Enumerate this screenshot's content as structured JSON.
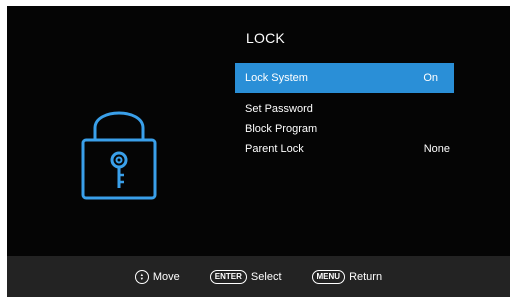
{
  "menu": {
    "title": "LOCK",
    "items": [
      {
        "label": "Lock System",
        "value": "On",
        "selected": true
      },
      {
        "label": "Set Password",
        "value": ""
      },
      {
        "label": "Block Program",
        "value": ""
      },
      {
        "label": "Parent Lock",
        "value": "None"
      }
    ]
  },
  "footer": {
    "move": {
      "icon": "up-down-icon",
      "label": "Move"
    },
    "select": {
      "key": "ENTER",
      "label": "Select"
    },
    "return": {
      "key": "MENU",
      "label": "Return"
    }
  },
  "colors": {
    "background": "#050505",
    "highlight": "#2a8fd7",
    "lock_icon": "#3aa0ea",
    "footer_bar": "#232323"
  },
  "icons": {
    "lock": "padlock-key-icon"
  }
}
